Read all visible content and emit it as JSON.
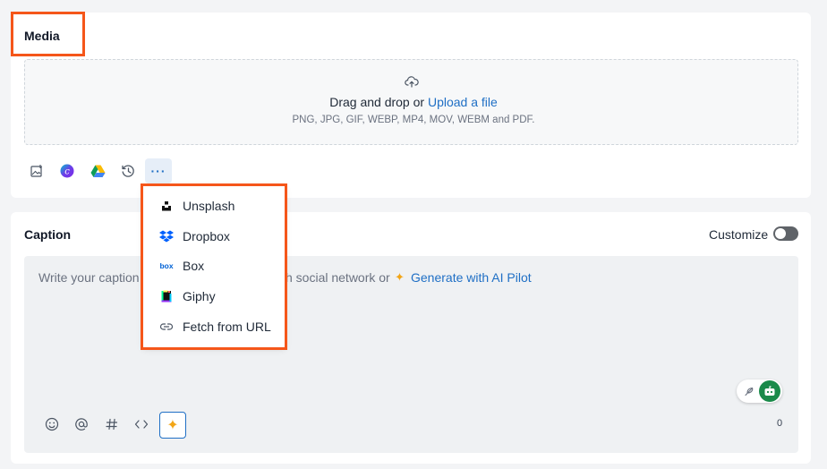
{
  "media": {
    "title": "Media",
    "dropzone": {
      "text": "Drag and drop or",
      "link": "Upload a file",
      "formats": "PNG, JPG, GIF, WEBP, MP4, MOV, WEBM and PDF."
    },
    "toolbar": [
      "image-library-icon",
      "canva-icon",
      "google-drive-icon",
      "history-icon",
      "more-icon"
    ],
    "more_label": "···"
  },
  "menu": {
    "items": [
      {
        "label": "Unsplash",
        "icon": "unsplash-icon"
      },
      {
        "label": "Dropbox",
        "icon": "dropbox-icon"
      },
      {
        "label": "Box",
        "icon": "box-icon"
      },
      {
        "label": "Giphy",
        "icon": "giphy-icon"
      },
      {
        "label": "Fetch from URL",
        "icon": "link-icon"
      }
    ]
  },
  "caption": {
    "title": "Caption",
    "customize_label": "Customize",
    "customize_on": false,
    "placeholder_start": "Write your caption",
    "placeholder_end": "h social network or",
    "ai_link": "Generate with AI Pilot",
    "char_count": "0",
    "bottom_icons": [
      "emoji-icon",
      "mention-icon",
      "hashtag-icon",
      "code-icon",
      "ai-sparkle-icon"
    ]
  },
  "colors": {
    "highlight": "#f5561a",
    "link": "#1f6fc5",
    "ai_accent": "#f2a516",
    "assistant_green": "#1a8a4a"
  }
}
